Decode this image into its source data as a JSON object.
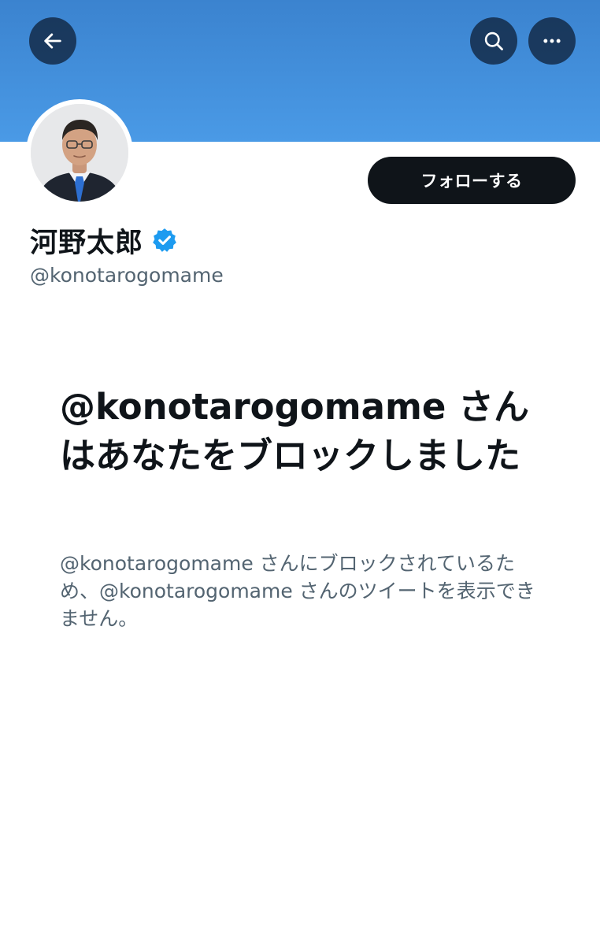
{
  "header": {
    "back_icon": "back-arrow-icon",
    "search_icon": "search-icon",
    "more_icon": "more-options-icon",
    "banner_color": "#4a9ae6"
  },
  "profile": {
    "display_name": "河野太郎",
    "verified": true,
    "handle": "@konotarogomame",
    "follow_label": "フォローする"
  },
  "blocked": {
    "title": "@konotarogomame さんはあなたをブロックしました",
    "description": "@konotarogomame さんにブロックされているため、@konotarogomame さんのツイートを表示できません。"
  },
  "colors": {
    "accent": "#1d9bf0",
    "follow_button": "#0f1419",
    "secondary_text": "#536471"
  }
}
